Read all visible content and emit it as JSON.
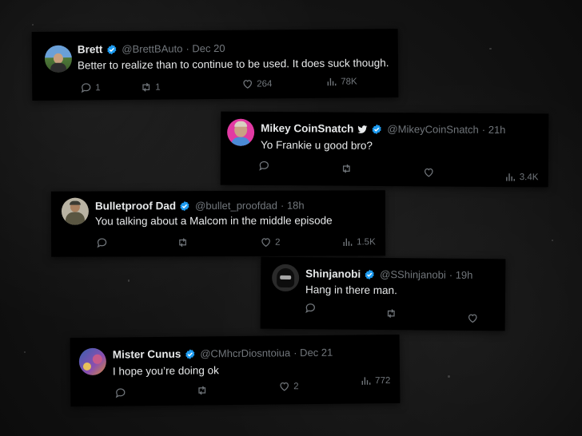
{
  "tweets": [
    {
      "name": "Brett",
      "handle": "@BrettBAuto",
      "time": "· Dec 20",
      "text": "Better to realize than to continue to be used. It does suck though.",
      "replies": "1",
      "retweets": "1",
      "likes": "264",
      "views": "78K"
    },
    {
      "name": "Mikey CoinSnatch",
      "handle": "@MikeyCoinSnatch",
      "time": "· 21h",
      "text": "Yo Frankie u good bro?",
      "replies": "",
      "retweets": "",
      "likes": "",
      "views": "3.4K"
    },
    {
      "name": "Bulletproof Dad",
      "handle": "@bullet_proofdad",
      "time": "· 18h",
      "text": "You talking about a Malcom in the middle episode",
      "replies": "",
      "retweets": "",
      "likes": "2",
      "views": "1.5K"
    },
    {
      "name": "Shinjanobi",
      "handle": "@SShinjanobi",
      "time": "· 19h",
      "text": "Hang in there man.",
      "replies": "",
      "retweets": "",
      "likes": ""
    },
    {
      "name": "Mister Cunus",
      "handle": "@CMhcrDiosntoiua",
      "time": "· Dec 21",
      "text": "I hope you’re doing ok",
      "replies": "",
      "retweets": "",
      "likes": "2",
      "views": "772"
    }
  ],
  "colors": {
    "verified": "#1d9bf0",
    "muted": "#71767b",
    "text": "#e7e9ea"
  }
}
